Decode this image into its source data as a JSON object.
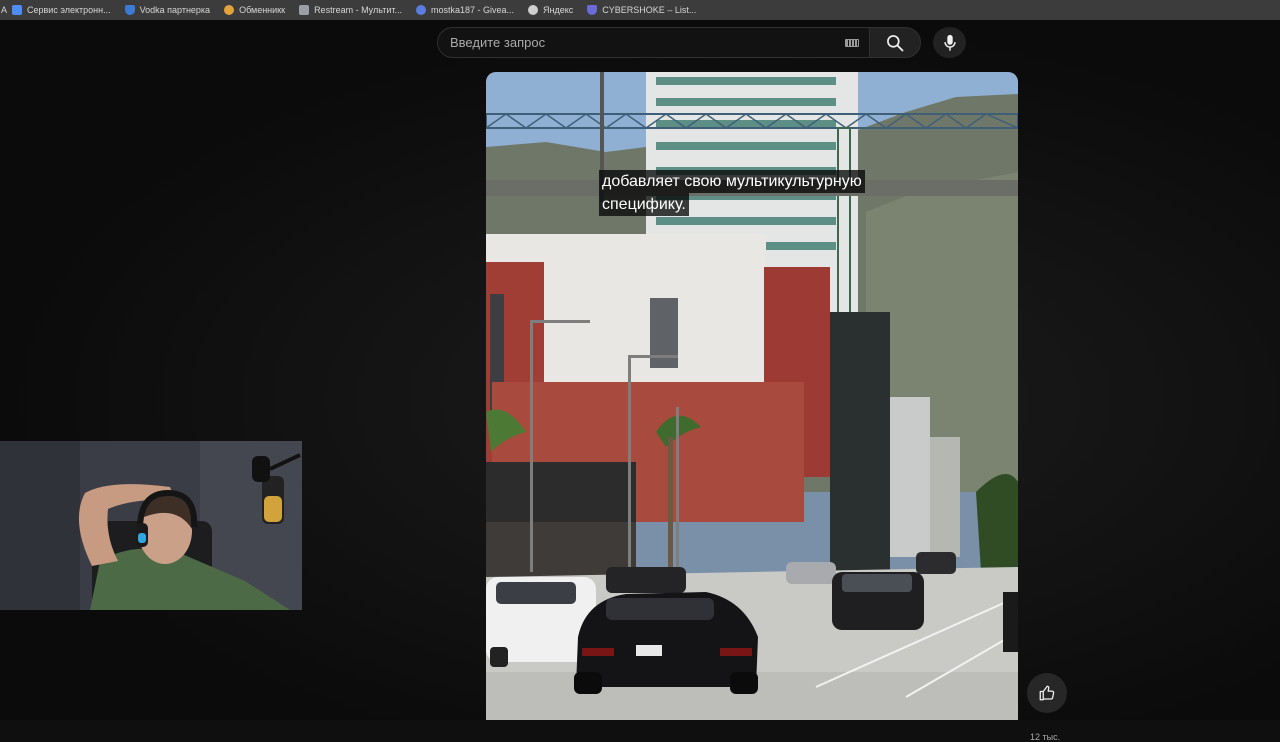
{
  "bookmarks": {
    "lead": "A",
    "items": [
      {
        "label": "Сервис электронн...",
        "icon": "doc-icon",
        "color": "#4e8df5"
      },
      {
        "label": "Vodka партнерка",
        "icon": "shield-icon",
        "color": "#3a7bd5"
      },
      {
        "label": "Обменникк",
        "icon": "exchange-icon",
        "color": "#e3a33b"
      },
      {
        "label": "Restream - Мультит...",
        "icon": "restream-icon",
        "color": "#9aa0a6"
      },
      {
        "label": "mostka187 - Givea...",
        "icon": "globe-icon",
        "color": "#5b7de0"
      },
      {
        "label": "Яндекс",
        "icon": "yandex-icon",
        "color": "#cfcfcf"
      },
      {
        "label": "CYBERSHOKE – List...",
        "icon": "cybershoke-icon",
        "color": "#6a6ad8"
      }
    ]
  },
  "search": {
    "placeholder": "Введите запрос",
    "value": ""
  },
  "video": {
    "caption_line1": "добавляет свою мультикультурную",
    "caption_line2": "специфику."
  },
  "actions": {
    "like_count": "12 тыс."
  },
  "colors": {
    "background": "#0f0f0f",
    "bookmarks_bar": "#3c3c3c",
    "search_border": "#303030",
    "button_bg": "#222222"
  }
}
